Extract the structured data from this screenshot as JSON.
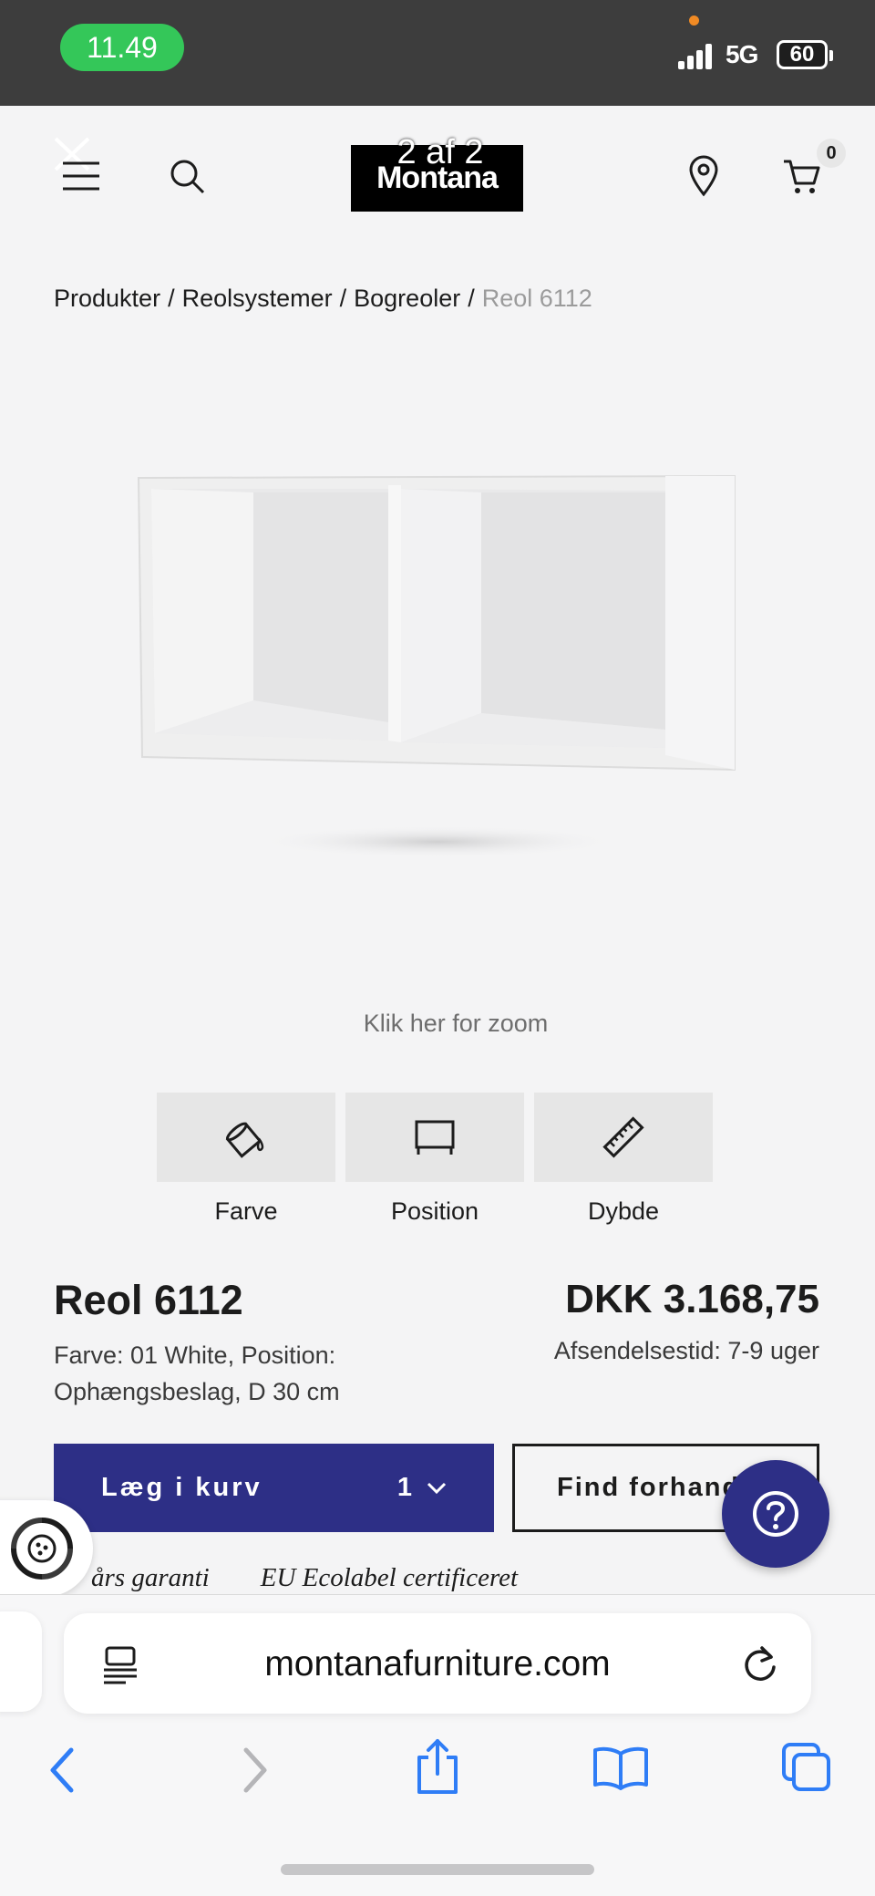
{
  "status_bar": {
    "time": "11.49",
    "network": "5G",
    "battery": "60"
  },
  "nav": {
    "logo": "Montana",
    "gallery_counter": "2 af 2",
    "cart_count": "0"
  },
  "breadcrumb": {
    "items": [
      "Produkter",
      "Reolsystemer",
      "Bogreoler"
    ],
    "current": "Reol 6112",
    "separator": "/"
  },
  "gallery": {
    "zoom_hint": "Klik her for zoom"
  },
  "options": [
    {
      "label": "Farve",
      "icon": "paint-bucket-icon"
    },
    {
      "label": "Position",
      "icon": "wall-mount-icon"
    },
    {
      "label": "Dybde",
      "icon": "ruler-icon"
    }
  ],
  "product": {
    "title": "Reol 6112",
    "description": "Farve: 01 White, Position: Ophængsbeslag, D 30 cm",
    "price": "DKK 3.168,75",
    "shipping": "Afsendelsestid: 7-9 uger"
  },
  "actions": {
    "add_to_cart": "Læg i kurv",
    "quantity": "1",
    "find_dealer": "Find forhandler"
  },
  "badges": {
    "warranty": "års garanti",
    "ecolabel": "EU Ecolabel certificeret"
  },
  "browser": {
    "url": "montanafurniture.com"
  },
  "colors": {
    "accent": "#2d2f86",
    "status_green": "#34c759",
    "link_blue": "#2f7df6"
  }
}
